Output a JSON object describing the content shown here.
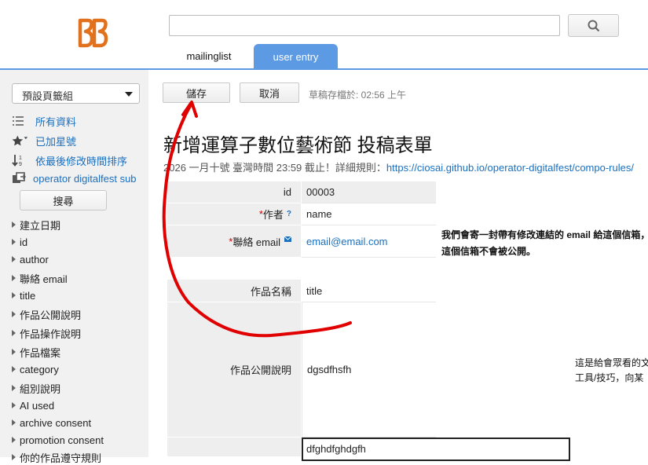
{
  "header": {
    "logo_text": "BB",
    "search": {
      "value": "",
      "placeholder": ""
    },
    "tabs": [
      {
        "label": "mailinglist",
        "active": false
      },
      {
        "label": "user entry",
        "active": true
      }
    ]
  },
  "colors": {
    "accent": "#5c9ae4",
    "logo": "#e2711d",
    "link": "#1a6fbf",
    "required": "#cc0000",
    "annotation": "#e00000"
  },
  "sidebar": {
    "bookmark_group": "預設頁籤組",
    "nav": [
      {
        "label": "所有資料",
        "icon": "list-icon"
      },
      {
        "label": "已加星號",
        "icon": "star-icon"
      },
      {
        "label": "依最後修改時間排序",
        "icon": "sort-icon"
      },
      {
        "label": "operator digitalfest sub",
        "icon": "form-link-icon"
      }
    ],
    "search_label": "搜尋",
    "fields": [
      "建立日期",
      "id",
      "author",
      "聯絡 email",
      "title",
      "作品公開說明",
      "作品操作說明",
      "作品檔案",
      "category",
      "組別說明",
      "AI used",
      "archive consent",
      "promotion consent",
      "你的作品遵守規則"
    ]
  },
  "toolbar": {
    "save_label": "儲存",
    "cancel_label": "取消",
    "draft_status": "草稿存檔於: 02:56 上午"
  },
  "form": {
    "title": "新增運算子數位藝術節 投稿表單",
    "desc_prefix": "2026 一月十號 臺灣時間 23:59 截止！詳細規則：",
    "desc_link": "https://ciosai.github.io/operator-digitalfest/compo-rules/",
    "rows": [
      {
        "label": "id",
        "value": "00003"
      },
      {
        "label_req": "*",
        "label": "作者",
        "help": "?",
        "value": "name"
      },
      {
        "label_req": "*",
        "label": "聯絡 email",
        "value": "email@email.com"
      },
      {
        "label": "作品名稱",
        "value": "title"
      },
      {
        "label": "作品公開說明",
        "value": "dgsdfhsfh"
      }
    ],
    "email_note": "我們會寄一封帶有修改連結的 email 給這個信箱，這個信箱不會被公開。",
    "public_note_line1": "這是給會眾看的文",
    "public_note_line2": "工具/技巧，向某",
    "operation_value": "dfghdfghdgfh"
  }
}
